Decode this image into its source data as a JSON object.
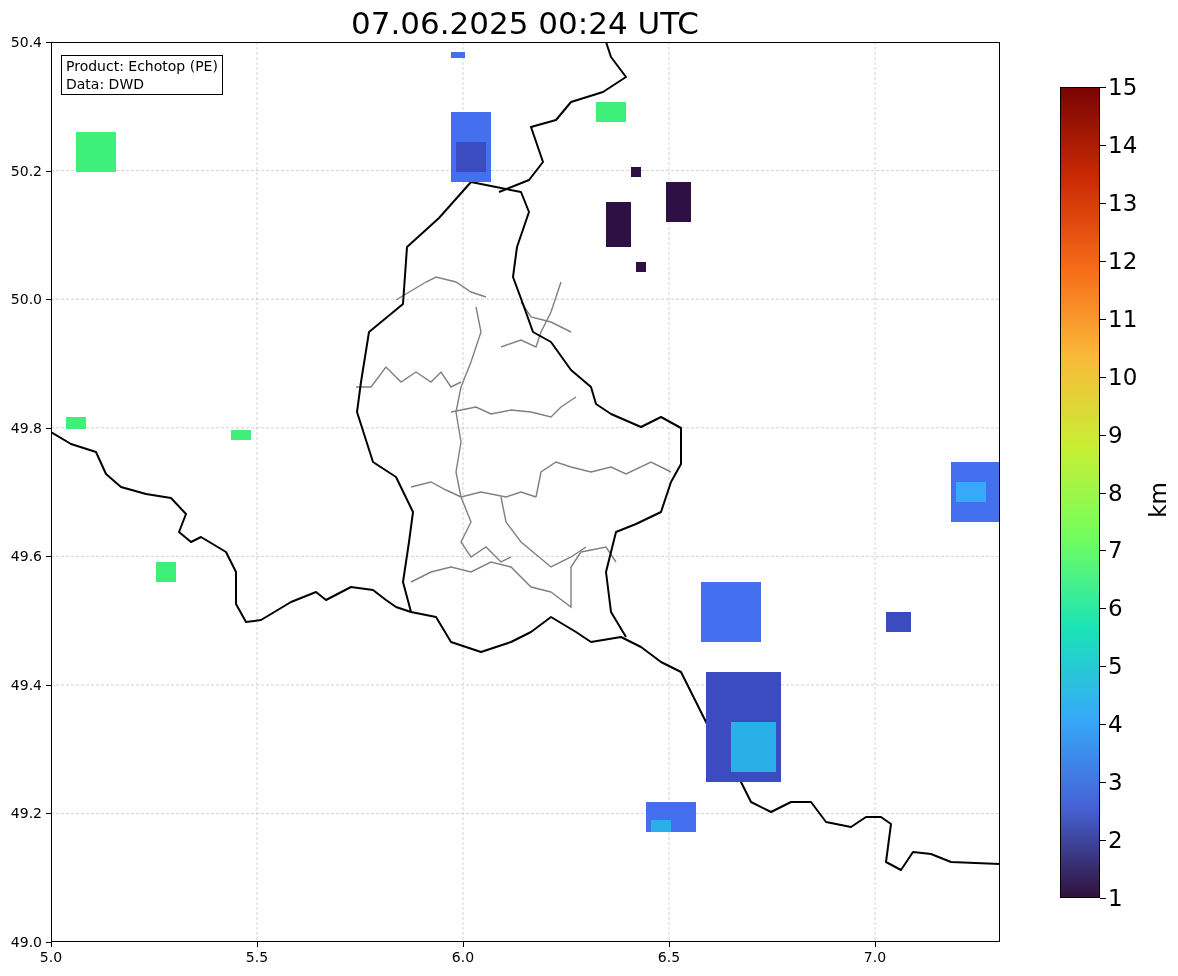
{
  "title": "07.06.2025 00:24 UTC",
  "info_box": [
    "Product: Echotop (PE)",
    "Data: DWD"
  ],
  "map": {
    "y_ticks": [
      "50.4",
      "50.2",
      "50.0",
      "49.8",
      "49.6",
      "49.4",
      "49.2",
      "49.0"
    ],
    "x_ticks": [
      "5.0",
      "5.5",
      "6.0",
      "6.5",
      "7.0"
    ]
  },
  "colorbar": {
    "label": "km",
    "ticks": [
      "15",
      "14",
      "13",
      "12",
      "11",
      "10",
      "9",
      "8",
      "7",
      "6",
      "5",
      "4",
      "3",
      "2",
      "1"
    ]
  }
}
